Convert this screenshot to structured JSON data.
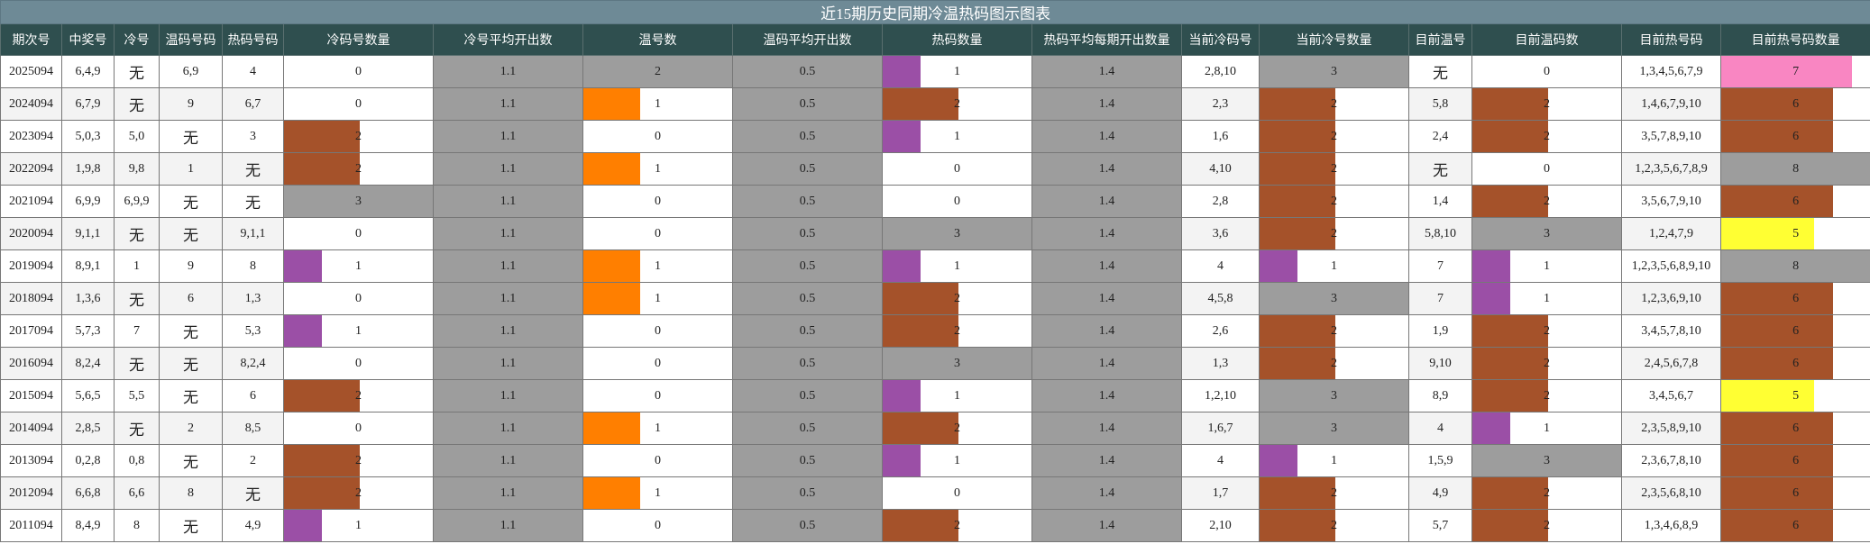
{
  "title": "近15期历史同期冷温热码图示图表",
  "headers": [
    "期次号",
    "中奖号",
    "冷号",
    "温码号码",
    "热码号码",
    "冷码号数量",
    "冷号平均开出数",
    "温号数",
    "温码平均开出数",
    "热码数量",
    "热码平均每期开出数量",
    "当前冷码号",
    "当前冷号数量",
    "目前温号",
    "目前温码数",
    "目前热号码",
    "目前热号码数量"
  ],
  "colors": {
    "purple": "#9b4fa6",
    "brown": "#a5522a",
    "orange": "#ff7f00",
    "gray": "#9d9d9d",
    "pink": "#f986c2",
    "yellow": "#ffff33",
    "white": "#ffffff"
  },
  "rows": [
    {
      "issue": "2025094",
      "win": "6,4,9",
      "cold": "无",
      "warm": "6,9",
      "hot": "4",
      "coldCnt": "0",
      "coldAvg": "1.1",
      "warmCnt": "2",
      "warmAvg": "0.5",
      "hotCnt": "1",
      "hotAvg": "1.4",
      "curCold": "2,8,10",
      "curColdCnt": "3",
      "curWarm": "无",
      "curWarmCnt": "0",
      "curHot": "1,3,4,5,6,7,9",
      "curHotCnt": "7"
    },
    {
      "issue": "2024094",
      "win": "6,7,9",
      "cold": "无",
      "warm": "9",
      "hot": "6,7",
      "coldCnt": "0",
      "coldAvg": "1.1",
      "warmCnt": "1",
      "warmAvg": "0.5",
      "hotCnt": "2",
      "hotAvg": "1.4",
      "curCold": "2,3",
      "curColdCnt": "2",
      "curWarm": "5,8",
      "curWarmCnt": "2",
      "curHot": "1,4,6,7,9,10",
      "curHotCnt": "6"
    },
    {
      "issue": "2023094",
      "win": "5,0,3",
      "cold": "5,0",
      "warm": "无",
      "hot": "3",
      "coldCnt": "2",
      "coldAvg": "1.1",
      "warmCnt": "0",
      "warmAvg": "0.5",
      "hotCnt": "1",
      "hotAvg": "1.4",
      "curCold": "1,6",
      "curColdCnt": "2",
      "curWarm": "2,4",
      "curWarmCnt": "2",
      "curHot": "3,5,7,8,9,10",
      "curHotCnt": "6"
    },
    {
      "issue": "2022094",
      "win": "1,9,8",
      "cold": "9,8",
      "warm": "1",
      "hot": "无",
      "coldCnt": "2",
      "coldAvg": "1.1",
      "warmCnt": "1",
      "warmAvg": "0.5",
      "hotCnt": "0",
      "hotAvg": "1.4",
      "curCold": "4,10",
      "curColdCnt": "2",
      "curWarm": "无",
      "curWarmCnt": "0",
      "curHot": "1,2,3,5,6,7,8,9",
      "curHotCnt": "8"
    },
    {
      "issue": "2021094",
      "win": "6,9,9",
      "cold": "6,9,9",
      "warm": "无",
      "hot": "无",
      "coldCnt": "3",
      "coldAvg": "1.1",
      "warmCnt": "0",
      "warmAvg": "0.5",
      "hotCnt": "0",
      "hotAvg": "1.4",
      "curCold": "2,8",
      "curColdCnt": "2",
      "curWarm": "1,4",
      "curWarmCnt": "2",
      "curHot": "3,5,6,7,9,10",
      "curHotCnt": "6"
    },
    {
      "issue": "2020094",
      "win": "9,1,1",
      "cold": "无",
      "warm": "无",
      "hot": "9,1,1",
      "coldCnt": "0",
      "coldAvg": "1.1",
      "warmCnt": "0",
      "warmAvg": "0.5",
      "hotCnt": "3",
      "hotAvg": "1.4",
      "curCold": "3,6",
      "curColdCnt": "2",
      "curWarm": "5,8,10",
      "curWarmCnt": "3",
      "curHot": "1,2,4,7,9",
      "curHotCnt": "5"
    },
    {
      "issue": "2019094",
      "win": "8,9,1",
      "cold": "1",
      "warm": "9",
      "hot": "8",
      "coldCnt": "1",
      "coldAvg": "1.1",
      "warmCnt": "1",
      "warmAvg": "0.5",
      "hotCnt": "1",
      "hotAvg": "1.4",
      "curCold": "4",
      "curColdCnt": "1",
      "curWarm": "7",
      "curWarmCnt": "1",
      "curHot": "1,2,3,5,6,8,9,10",
      "curHotCnt": "8"
    },
    {
      "issue": "2018094",
      "win": "1,3,6",
      "cold": "无",
      "warm": "6",
      "hot": "1,3",
      "coldCnt": "0",
      "coldAvg": "1.1",
      "warmCnt": "1",
      "warmAvg": "0.5",
      "hotCnt": "2",
      "hotAvg": "1.4",
      "curCold": "4,5,8",
      "curColdCnt": "3",
      "curWarm": "7",
      "curWarmCnt": "1",
      "curHot": "1,2,3,6,9,10",
      "curHotCnt": "6"
    },
    {
      "issue": "2017094",
      "win": "5,7,3",
      "cold": "7",
      "warm": "无",
      "hot": "5,3",
      "coldCnt": "1",
      "coldAvg": "1.1",
      "warmCnt": "0",
      "warmAvg": "0.5",
      "hotCnt": "2",
      "hotAvg": "1.4",
      "curCold": "2,6",
      "curColdCnt": "2",
      "curWarm": "1,9",
      "curWarmCnt": "2",
      "curHot": "3,4,5,7,8,10",
      "curHotCnt": "6"
    },
    {
      "issue": "2016094",
      "win": "8,2,4",
      "cold": "无",
      "warm": "无",
      "hot": "8,2,4",
      "coldCnt": "0",
      "coldAvg": "1.1",
      "warmCnt": "0",
      "warmAvg": "0.5",
      "hotCnt": "3",
      "hotAvg": "1.4",
      "curCold": "1,3",
      "curColdCnt": "2",
      "curWarm": "9,10",
      "curWarmCnt": "2",
      "curHot": "2,4,5,6,7,8",
      "curHotCnt": "6"
    },
    {
      "issue": "2015094",
      "win": "5,6,5",
      "cold": "5,5",
      "warm": "无",
      "hot": "6",
      "coldCnt": "2",
      "coldAvg": "1.1",
      "warmCnt": "0",
      "warmAvg": "0.5",
      "hotCnt": "1",
      "hotAvg": "1.4",
      "curCold": "1,2,10",
      "curColdCnt": "3",
      "curWarm": "8,9",
      "curWarmCnt": "2",
      "curHot": "3,4,5,6,7",
      "curHotCnt": "5"
    },
    {
      "issue": "2014094",
      "win": "2,8,5",
      "cold": "无",
      "warm": "2",
      "hot": "8,5",
      "coldCnt": "0",
      "coldAvg": "1.1",
      "warmCnt": "1",
      "warmAvg": "0.5",
      "hotCnt": "2",
      "hotAvg": "1.4",
      "curCold": "1,6,7",
      "curColdCnt": "3",
      "curWarm": "4",
      "curWarmCnt": "1",
      "curHot": "2,3,5,8,9,10",
      "curHotCnt": "6"
    },
    {
      "issue": "2013094",
      "win": "0,2,8",
      "cold": "0,8",
      "warm": "无",
      "hot": "2",
      "coldCnt": "2",
      "coldAvg": "1.1",
      "warmCnt": "0",
      "warmAvg": "0.5",
      "hotCnt": "1",
      "hotAvg": "1.4",
      "curCold": "4",
      "curColdCnt": "1",
      "curWarm": "1,5,9",
      "curWarmCnt": "3",
      "curHot": "2,3,6,7,8,10",
      "curHotCnt": "6"
    },
    {
      "issue": "2012094",
      "win": "6,6,8",
      "cold": "6,6",
      "warm": "8",
      "hot": "无",
      "coldCnt": "2",
      "coldAvg": "1.1",
      "warmCnt": "1",
      "warmAvg": "0.5",
      "hotCnt": "0",
      "hotAvg": "1.4",
      "curCold": "1,7",
      "curColdCnt": "2",
      "curWarm": "4,9",
      "curWarmCnt": "2",
      "curHot": "2,3,5,6,8,10",
      "curHotCnt": "6"
    },
    {
      "issue": "2011094",
      "win": "8,4,9",
      "cold": "8",
      "warm": "无",
      "hot": "4,9",
      "coldCnt": "1",
      "coldAvg": "1.1",
      "warmCnt": "0",
      "warmAvg": "0.5",
      "hotCnt": "2",
      "hotAvg": "1.4",
      "curCold": "2,10",
      "curColdCnt": "2",
      "curWarm": "5,7",
      "curWarmCnt": "2",
      "curHot": "1,3,4,6,8,9",
      "curHotCnt": "6"
    }
  ],
  "chart_data": {
    "type": "table",
    "title": "近15期历史同期冷温热码图示图表",
    "series": [
      {
        "name": "冷码号数量",
        "values": [
          0,
          0,
          2,
          2,
          3,
          0,
          1,
          0,
          1,
          0,
          2,
          0,
          2,
          2,
          1
        ]
      },
      {
        "name": "温号数",
        "values": [
          2,
          1,
          0,
          1,
          0,
          0,
          1,
          1,
          0,
          0,
          0,
          1,
          0,
          1,
          0
        ]
      },
      {
        "name": "热码数量",
        "values": [
          1,
          2,
          1,
          0,
          0,
          3,
          1,
          2,
          2,
          3,
          1,
          2,
          1,
          0,
          2
        ]
      },
      {
        "name": "当前冷号数量",
        "values": [
          3,
          2,
          2,
          2,
          2,
          2,
          1,
          3,
          2,
          2,
          3,
          3,
          1,
          2,
          2
        ]
      },
      {
        "name": "目前温码数",
        "values": [
          0,
          2,
          2,
          0,
          2,
          3,
          1,
          1,
          2,
          2,
          2,
          1,
          3,
          2,
          2
        ]
      },
      {
        "name": "目前热号码数量",
        "values": [
          7,
          6,
          6,
          8,
          6,
          5,
          8,
          6,
          6,
          6,
          5,
          6,
          6,
          6,
          6
        ]
      }
    ]
  }
}
